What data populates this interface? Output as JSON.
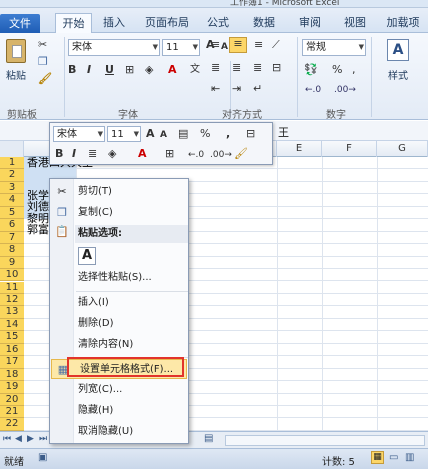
{
  "window": {
    "title": "工作簿1 - Microsoft Excel"
  },
  "tabs": [
    "文件",
    "开始",
    "插入",
    "页面布局",
    "公式",
    "数据",
    "审阅",
    "视图",
    "加载项"
  ],
  "ribbon": {
    "paste_label": "粘贴",
    "font_name": "宋体",
    "font_size": "11",
    "number_format": "常规",
    "styles_label": "样式",
    "groups": [
      "剪贴板",
      "字体",
      "对齐方式",
      "数字"
    ]
  },
  "mini_toolbar": {
    "font_name": "宋体",
    "font_size": "11"
  },
  "formula_bar": {
    "value_fragment": "王"
  },
  "columns": [
    "E",
    "F",
    "G"
  ],
  "rows": [
    "1",
    "2",
    "3",
    "4",
    "5",
    "6",
    "7",
    "8",
    "9",
    "10",
    "11",
    "12",
    "13",
    "14",
    "15",
    "16",
    "17",
    "18",
    "19",
    "20",
    "21",
    "22"
  ],
  "cells": [
    "香港四大天王",
    "张学",
    "刘德",
    "黎明",
    "郭富"
  ],
  "context_menu": {
    "cut": "剪切(T)",
    "copy": "复制(C)",
    "paste_options": "粘贴选项:",
    "paste_special": "选择性粘贴(S)...",
    "insert": "插入(I)",
    "delete": "删除(D)",
    "clear": "清除内容(N)",
    "format_cells": "设置单元格格式(F)...",
    "column_width": "列宽(C)...",
    "hide": "隐藏(H)",
    "unhide": "取消隐藏(U)"
  },
  "status": {
    "mode": "就绪",
    "count": "计数: 5"
  }
}
